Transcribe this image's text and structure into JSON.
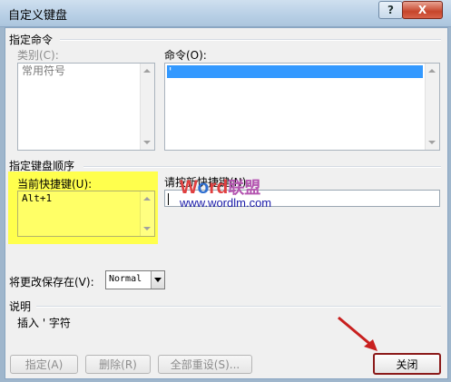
{
  "window": {
    "title": "自定义键盘",
    "help_button": "?",
    "close_button": "X"
  },
  "specify_command": {
    "section_label": "指定命令",
    "categories_label": "类别(C):",
    "categories_items": [
      "常用符号"
    ],
    "commands_label": "命令(O):",
    "commands_items": [
      "'"
    ]
  },
  "key_sequence": {
    "section_label": "指定键盘顺序",
    "current_keys_label": "当前快捷键(U):",
    "current_keys_items": [
      "Alt+1"
    ],
    "new_key_label": "请按新快捷键(N):",
    "new_key_value": ""
  },
  "save_in": {
    "label": "将更改保存在(V):",
    "selected": "Normal"
  },
  "description": {
    "label": "说明",
    "text": "插入 ' 字符"
  },
  "buttons": {
    "assign": "指定(A)",
    "remove": "删除(R)",
    "reset_all": "全部重设(S)...",
    "close": "关闭"
  },
  "watermark": {
    "brand_w": "W",
    "brand_o": "o",
    "brand_rd": "rd",
    "brand_cn": "联盟",
    "url": "www.wordlm.com"
  },
  "colors": {
    "highlight": "#ffff4d",
    "selection": "#3399ff",
    "arrow": "#c8201f",
    "close_border": "#8b1a1a"
  }
}
